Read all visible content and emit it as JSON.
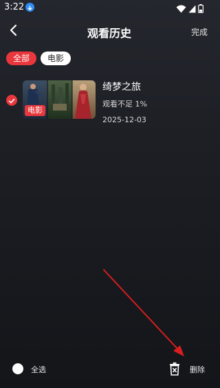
{
  "status_bar": {
    "time": "3:22",
    "download_icon": "download-icon",
    "wifi_icon": "wifi-icon",
    "signal_icon": "signal-icon",
    "battery_icon": "battery-icon"
  },
  "header": {
    "back_icon": "chevron-left-icon",
    "title": "观看历史",
    "done_label": "完成"
  },
  "filters": [
    {
      "label": "全部",
      "active": true
    },
    {
      "label": "电影",
      "active": false
    }
  ],
  "history_items": [
    {
      "selected": true,
      "tag": "电影",
      "title": "绮梦之旅",
      "progress": "观看不足 1%",
      "date": "2025-12-03"
    }
  ],
  "bottom_bar": {
    "select_all_label": "全选",
    "delete_label": "删除",
    "delete_icon": "trash-icon"
  },
  "colors": {
    "accent": "#e8383d",
    "arrow": "#d81e1e",
    "status_download": "#2f8df5"
  }
}
